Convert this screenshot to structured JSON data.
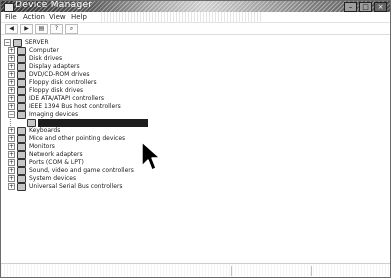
{
  "window": {
    "title": "Device Manager"
  },
  "menubar": {
    "items": [
      {
        "label": "File",
        "name": "menu-file"
      },
      {
        "label": "Action",
        "name": "menu-action"
      },
      {
        "label": "View",
        "name": "menu-view"
      },
      {
        "label": "Help",
        "name": "menu-help"
      }
    ]
  },
  "toolbar": {
    "buttons": [
      {
        "name": "back-button",
        "icon": "back-arrow-icon",
        "glyph": "◀"
      },
      {
        "name": "forward-button",
        "icon": "forward-arrow-icon",
        "glyph": "▶"
      },
      {
        "name": "properties-button",
        "icon": "properties-icon",
        "glyph": "▤"
      },
      {
        "name": "help-button",
        "icon": "help-icon",
        "glyph": "?"
      },
      {
        "name": "scan-hardware-button",
        "icon": "scan-icon",
        "glyph": "⌕"
      }
    ]
  },
  "tree": {
    "root": {
      "label": "SERVER",
      "icon": "computer-icon",
      "expander": "−"
    },
    "items": [
      {
        "label": "Computer",
        "icon": "computer-icon",
        "expander": "+"
      },
      {
        "label": "Disk drives",
        "icon": "disk-drive-icon",
        "expander": "+"
      },
      {
        "label": "Display adapters",
        "icon": "display-adapter-icon",
        "expander": "+"
      },
      {
        "label": "DVD/CD-ROM drives",
        "icon": "dvd-drive-icon",
        "expander": "+"
      },
      {
        "label": "Floppy disk controllers",
        "icon": "floppy-controller-icon",
        "expander": "+"
      },
      {
        "label": "Floppy disk drives",
        "icon": "floppy-drive-icon",
        "expander": "+"
      },
      {
        "label": "IDE ATA/ATAPI controllers",
        "icon": "ide-controller-icon",
        "expander": "+"
      },
      {
        "label": "IEEE 1394 Bus host controllers",
        "icon": "ieee1394-icon",
        "expander": "+"
      },
      {
        "label": "Imaging devices",
        "icon": "imaging-device-icon",
        "expander": "−"
      },
      {
        "label": "",
        "icon": "camera-icon",
        "expander": "",
        "child": true,
        "selected": true
      },
      {
        "label": "Keyboards",
        "icon": "keyboard-icon",
        "expander": "+"
      },
      {
        "label": "Mice and other pointing devices",
        "icon": "mouse-icon",
        "expander": "+"
      },
      {
        "label": "Monitors",
        "icon": "monitor-icon",
        "expander": "+"
      },
      {
        "label": "Network adapters",
        "icon": "network-adapter-icon",
        "expander": "+"
      },
      {
        "label": "Ports (COM & LPT)",
        "icon": "port-icon",
        "expander": "+"
      },
      {
        "label": "Sound, video and game controllers",
        "icon": "sound-icon",
        "expander": "+"
      },
      {
        "label": "System devices",
        "icon": "system-device-icon",
        "expander": "+"
      },
      {
        "label": "Universal Serial Bus controllers",
        "icon": "usb-icon",
        "expander": "+"
      }
    ]
  },
  "statusbar": {
    "text": ""
  },
  "colors": {
    "selection": "#2a2a2a",
    "title_gradient_dark": "#3d3d3d",
    "title_gradient_light": "#c4c4c4"
  }
}
